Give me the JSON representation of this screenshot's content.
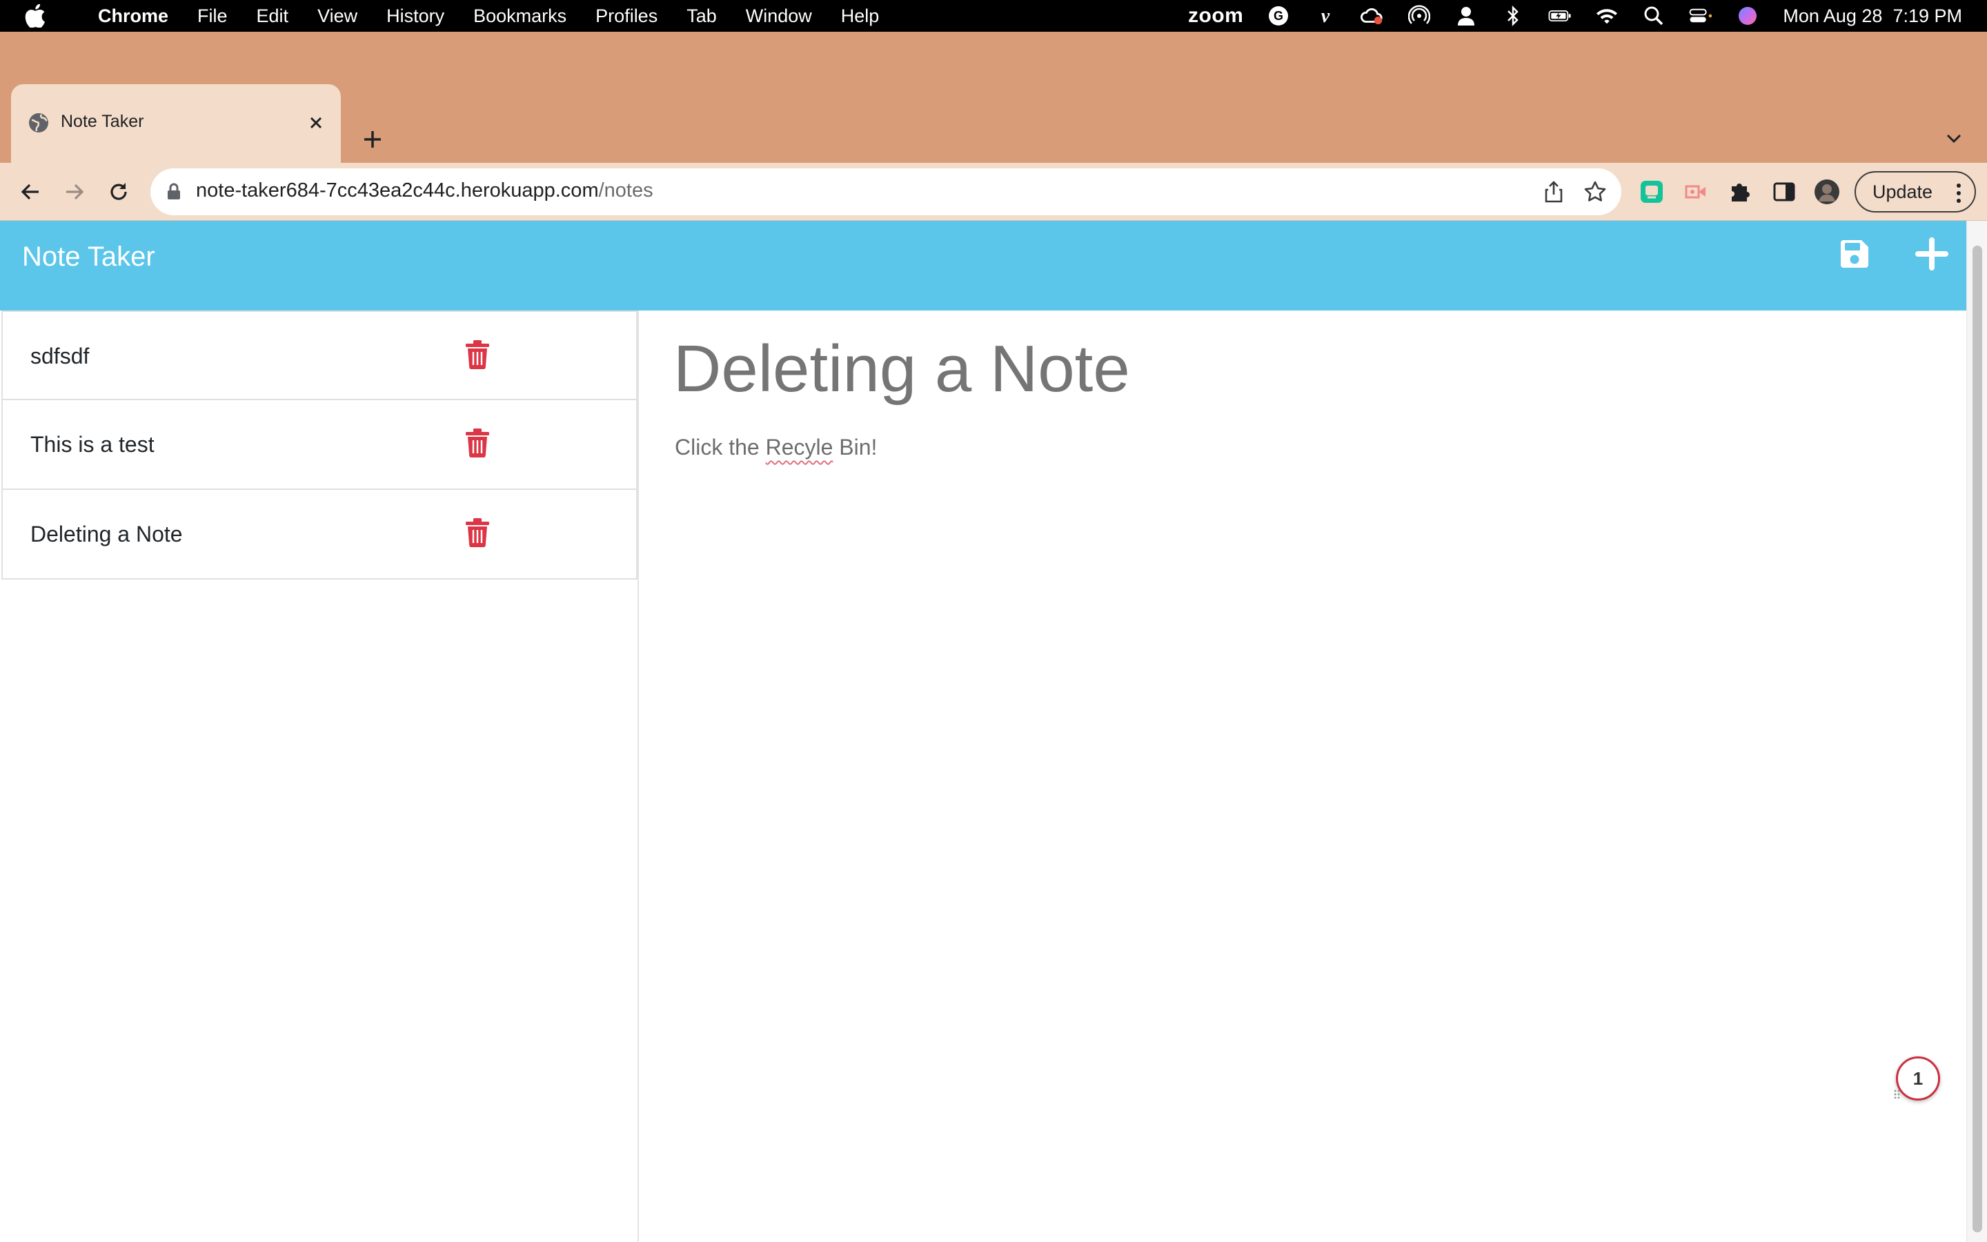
{
  "menubar": {
    "app_name": "Chrome",
    "items": [
      "File",
      "Edit",
      "View",
      "History",
      "Bookmarks",
      "Profiles",
      "Tab",
      "Window",
      "Help"
    ],
    "zoom_label": "zoom",
    "datetime": "Mon Aug 28  7:19 PM"
  },
  "browser": {
    "tab_title": "Note Taker",
    "url_host": "note-taker684-7cc43ea2c44c.herokuapp.com",
    "url_path": "/notes",
    "update_label": "Update"
  },
  "app": {
    "brand": "Note Taker",
    "notes": [
      {
        "title": "sdfsdf"
      },
      {
        "title": "This is a test"
      },
      {
        "title": "Deleting a Note"
      }
    ],
    "active_note": {
      "title": "Deleting a Note",
      "text_before": "Click the ",
      "text_misspelled": "Recyle",
      "text_after": " Bin!"
    },
    "badge_count": "1"
  },
  "colors": {
    "navbar": "#5bc5ea",
    "trash": "#dc3545",
    "tabstrip": "#d89d78",
    "toolbar": "#f3dcca"
  }
}
